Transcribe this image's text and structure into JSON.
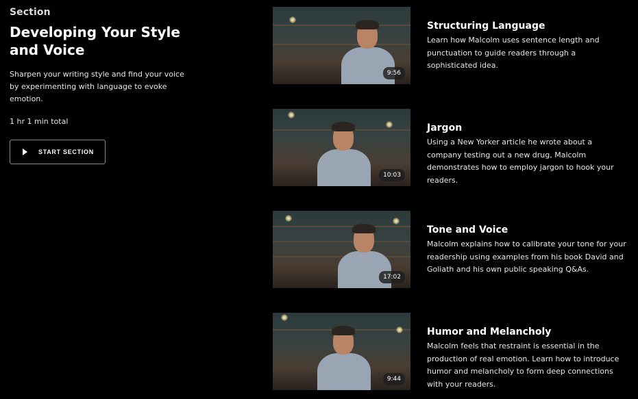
{
  "section": {
    "eyebrow": "Section",
    "title": "Developing Your Style and Voice",
    "description": "Sharpen your writing style and find your voice by experimenting with language to evoke emotion.",
    "total": "1 hr 1 min total",
    "start_button": "START SECTION"
  },
  "lessons": [
    {
      "title": "Structuring Language",
      "description": "Learn how Malcolm uses sentence length and punctuation to guide readers through a sophisticated idea.",
      "duration": "9:56"
    },
    {
      "title": "Jargon",
      "description": "Using a New Yorker article he wrote about a company testing out a new drug, Malcolm demonstrates how to employ jargon to hook your readers.",
      "duration": "10:03"
    },
    {
      "title": "Tone and Voice",
      "description": "Malcolm explains how to calibrate your tone for your readership using examples from his book David and Goliath and his own public speaking Q&As.",
      "duration": "17:02"
    },
    {
      "title": "Humor and Melancholy",
      "description": "Malcolm feels that restraint is essential in the production of real emotion. Learn how to introduce humor and melancholy to form deep connections with your readers.",
      "duration": "9:44"
    }
  ],
  "icons": {
    "start": "play-icon"
  }
}
